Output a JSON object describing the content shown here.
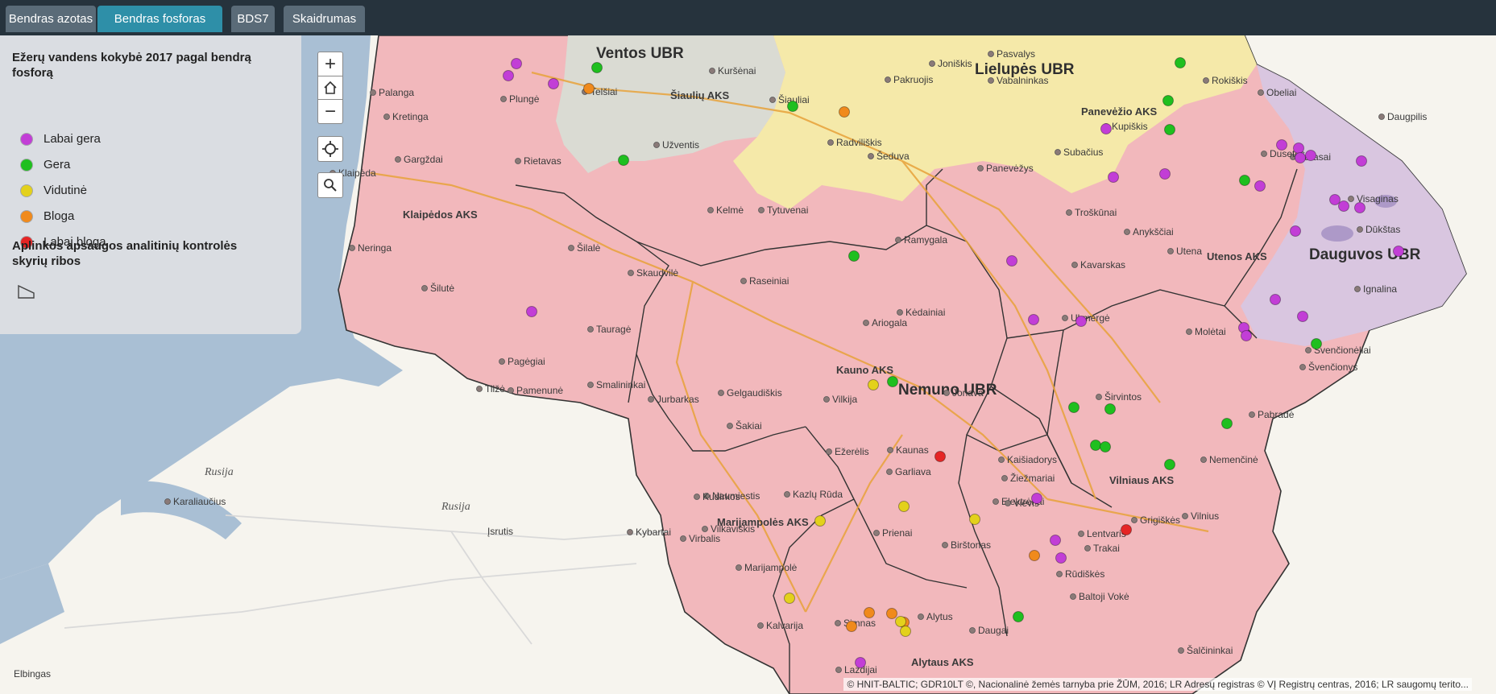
{
  "tabs": [
    {
      "label": "Bendras azotas",
      "active": false
    },
    {
      "label": "Bendras fosforas",
      "active": true
    },
    {
      "label": "BDS7",
      "active": false
    },
    {
      "label": "Skaidrumas",
      "active": false
    }
  ],
  "legend": {
    "title": "Ežerų vandens kokybė 2017 pagal bendrą fosforą",
    "classes": [
      {
        "label": "Labai gera",
        "color": "#c23ed6"
      },
      {
        "label": "Gera",
        "color": "#1fbf1f"
      },
      {
        "label": "Vidutinė",
        "color": "#e3d11c"
      },
      {
        "label": "Bloga",
        "color": "#f08a1c"
      },
      {
        "label": "Labai bloga",
        "color": "#e52525"
      }
    ],
    "boundary_title": "Aplinkos apsaugos analitinių kontrolės skyrių ribos",
    "boundary_icon": "polygon-icon"
  },
  "controls": {
    "zoom_in": "+",
    "home_icon": "home-icon",
    "zoom_out": "−",
    "locate_icon": "locate-icon",
    "search_icon": "search-icon"
  },
  "ubr_labels": [
    "Ventos UBR",
    "Lielupės UBR",
    "Nemuno UBR",
    "Dauguvos UBR"
  ],
  "aks_labels": [
    "Šiaulių AKS",
    "Panevėžio AKS",
    "Klaipėdos AKS",
    "Utenos AKS",
    "Kauno AKS",
    "Marijampolės AKS",
    "Vilniaus AKS",
    "Alytaus AKS"
  ],
  "towns": [
    "Palanga",
    "Kretinga",
    "Plungė",
    "Telšiai",
    "Gargždai",
    "Rietavas",
    "Klaipėda",
    "Neringa",
    "Šilutė",
    "Šilalė",
    "Tauragė",
    "Pagėgiai",
    "Tilžė",
    "Pamenunė",
    "Kuršėnai",
    "Šiauliai",
    "Užventis",
    "Radviliškis",
    "Šeduva",
    "Kelmė",
    "Tytuvenai",
    "Raseiniai",
    "Skaudvilė",
    "Jurbarkas",
    "Smalininkai",
    "Gelgaudiškis",
    "Šakiai",
    "Pasvalys",
    "Pakruojis",
    "Joniškis",
    "Vabalninkas",
    "Rokiškis",
    "Obeliai",
    "Kupiškis",
    "Subačius",
    "Panevėžys",
    "Ramygala",
    "Kėdainiai",
    "Ariogala",
    "Jonava",
    "Vilkija",
    "Kaunas",
    "Ežerėlis",
    "Garliava",
    "Kaišiadorys",
    "Žiežmariai",
    "Elektrėnai",
    "Vievis",
    "Ukmergė",
    "Širvintos",
    "Anykščiai",
    "Troškūnai",
    "Kavarskas",
    "Utena",
    "Molėtai",
    "Zarasai",
    "Dusetos",
    "Visaginas",
    "Dūkštas",
    "Ignalina",
    "Švenčionėliai",
    "Švenčionys",
    "Pabradė",
    "Nemenčinė",
    "Vilnius",
    "Grigiškės",
    "Lentvaris",
    "Trakai",
    "Rūdiškės",
    "Baltoji Vokė",
    "Šalčininkai",
    "Kazlų Rūda",
    "Naumiestis",
    "Kudirkos",
    "Vilkaviškis",
    "Virbalis",
    "Kybartai",
    "Marijampolė",
    "Kalvarija",
    "Prienai",
    "Birštonas",
    "Alytus",
    "Daugai",
    "Lazdijai",
    "Simnas",
    "Daugpilis",
    "Karaliaučius",
    "Rusija",
    "Įsrutis",
    "Elbingas"
  ],
  "attribution": "© HNIT-BALTIC; GDR10LT ©, Nacionalinė žemės tarnyba prie ŽŪM, 2016; LR Adresų registras © VĮ Registrų centras, 2016; LR saugomų terito..."
}
